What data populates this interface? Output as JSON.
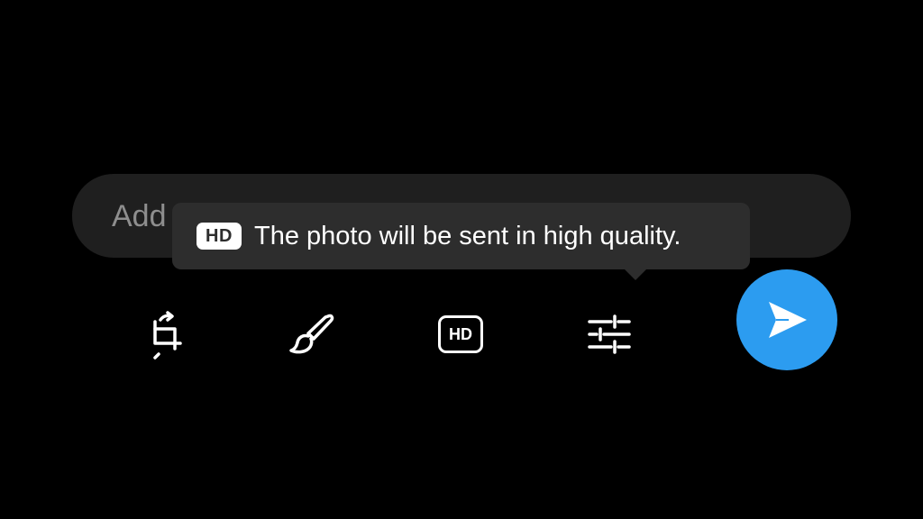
{
  "caption": {
    "placeholder": "Add a caption...",
    "value": ""
  },
  "tooltip": {
    "badge": "HD",
    "text": "The photo will be sent in high quality."
  },
  "toolbar": {
    "crop_rotate_icon": "crop-rotate-icon",
    "brush_icon": "brush-icon",
    "hd_label": "HD",
    "adjust_icon": "sliders-icon"
  },
  "send": {
    "icon": "send-icon",
    "color": "#2c9cf0"
  },
  "colors": {
    "background": "#000000",
    "caption_bar": "#1f1f1f",
    "tooltip_bg": "#2d2d2d",
    "accent": "#2c9cf0"
  }
}
